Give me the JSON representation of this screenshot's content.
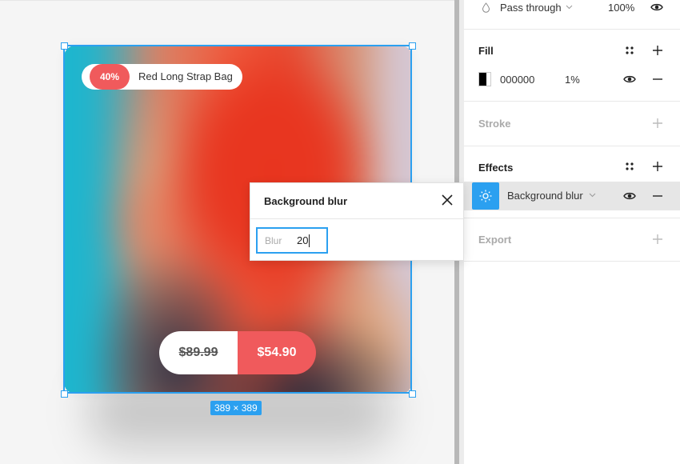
{
  "canvas": {
    "product": {
      "discount_badge": "40%",
      "name": "Red Long Strap Bag",
      "old_price": "$89.99",
      "new_price": "$54.90"
    },
    "selection_size": "389 × 389"
  },
  "popup": {
    "title": "Background blur",
    "blur_label": "Blur",
    "blur_value": "20"
  },
  "panel": {
    "layer": {
      "blend_mode": "Pass through",
      "opacity": "100%"
    },
    "fill": {
      "title": "Fill",
      "hex": "000000",
      "opacity": "1%",
      "swatch_color": "#000000"
    },
    "stroke": {
      "title": "Stroke"
    },
    "effects": {
      "title": "Effects",
      "item": "Background blur"
    },
    "export": {
      "title": "Export"
    }
  },
  "colors": {
    "accent_blue": "#2ba0f0",
    "badge_red": "#f05a5c"
  },
  "icons": [
    "droplet-icon",
    "chevron-down-icon",
    "eye-icon",
    "style-grid-icon",
    "plus-icon",
    "minus-icon",
    "sun-icon",
    "close-icon"
  ]
}
